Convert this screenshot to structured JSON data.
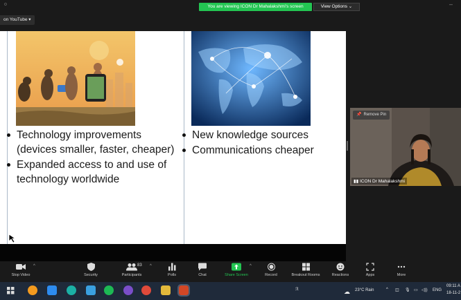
{
  "window": {
    "title": "o",
    "minimize": "–"
  },
  "banner": {
    "viewing_text": "You are viewing ICON Dr Mahalakshmi's screen",
    "view_options": "View Options ⌄"
  },
  "share_chip": {
    "label": "on YouTube ▾"
  },
  "slide": {
    "left_bullets": [
      "Technology improvements (devices smaller, faster, cheaper)",
      "Expanded access to and use of technology worldwide"
    ],
    "right_bullets": [
      "New knowledge sources",
      "Communications cheaper"
    ]
  },
  "video": {
    "remove_pin": "Remove Pin",
    "participant_name": "ICON Dr Mahalakshmi"
  },
  "toolbar": {
    "stop_video": "Stop Video",
    "security": "Security",
    "participants": "Participants",
    "participant_count": "83",
    "polls": "Polls",
    "chat": "Chat",
    "share_screen": "Share Screen",
    "record": "Record",
    "breakout_rooms": "Breakout Rooms",
    "reactions": "Reactions",
    "apps": "Apps",
    "more": "More"
  },
  "taskbar": {
    "weather": "23°C  Rain",
    "language": "ENG",
    "time": "09:11 A",
    "date": "18-11-2"
  },
  "colors": {
    "share_green": "#23c552",
    "toolbar_bg": "#1a1a1a",
    "taskbar_bg": "#1f2a3a"
  }
}
